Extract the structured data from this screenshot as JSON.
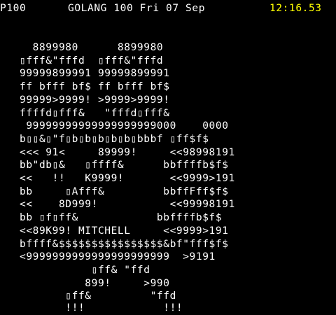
{
  "header": {
    "page_number": "P100",
    "service_name": "GOLANG",
    "page_ref": "100",
    "weekday": "Fri",
    "day": "07",
    "month": "Sep",
    "time": "12:16.53"
  },
  "colors": {
    "background": "#000000",
    "text": "#ffffff",
    "clock": "#ffff00"
  },
  "art_lines": [
    "     8899980      8899980",
    "   ▯fff&\"fffd  ▯fff&\"fffd",
    "   99999899991 99999899991",
    "   ff bfff bf$ ff bfff bf$",
    "   99999>9999! >9999>9999!",
    "   ffffd▯fff&   \"fffd▯fff&",
    "    99999999999999999999000    0000",
    "   b▯▯&▯\"f▯b▯b▯b▯b▯b▯bbbf ▯ff$f$",
    "   <<< 91<     89999!     <<98998191",
    "   bb\"db▯&   ▯ffff&      bbffffb$f$",
    "   <<   !!   K9999!       <<9999>191",
    "   bb     ▯Afff&         bbffFff$f$",
    "   <<    8D999!           <<99998191",
    "   bb ▯f▯ff&            bbffffb$f$",
    "   <<89K99! MITCHELL     <<9999>191",
    "   bffff&$$$$$$$$$$$$$$$$&bf\"fff$f$",
    "   <9999999999999999999999  >9191",
    "              ▯ff& \"ffd",
    "             899!     >990",
    "          ▯ff&         \"ffd",
    "          !!!            !!!"
  ]
}
